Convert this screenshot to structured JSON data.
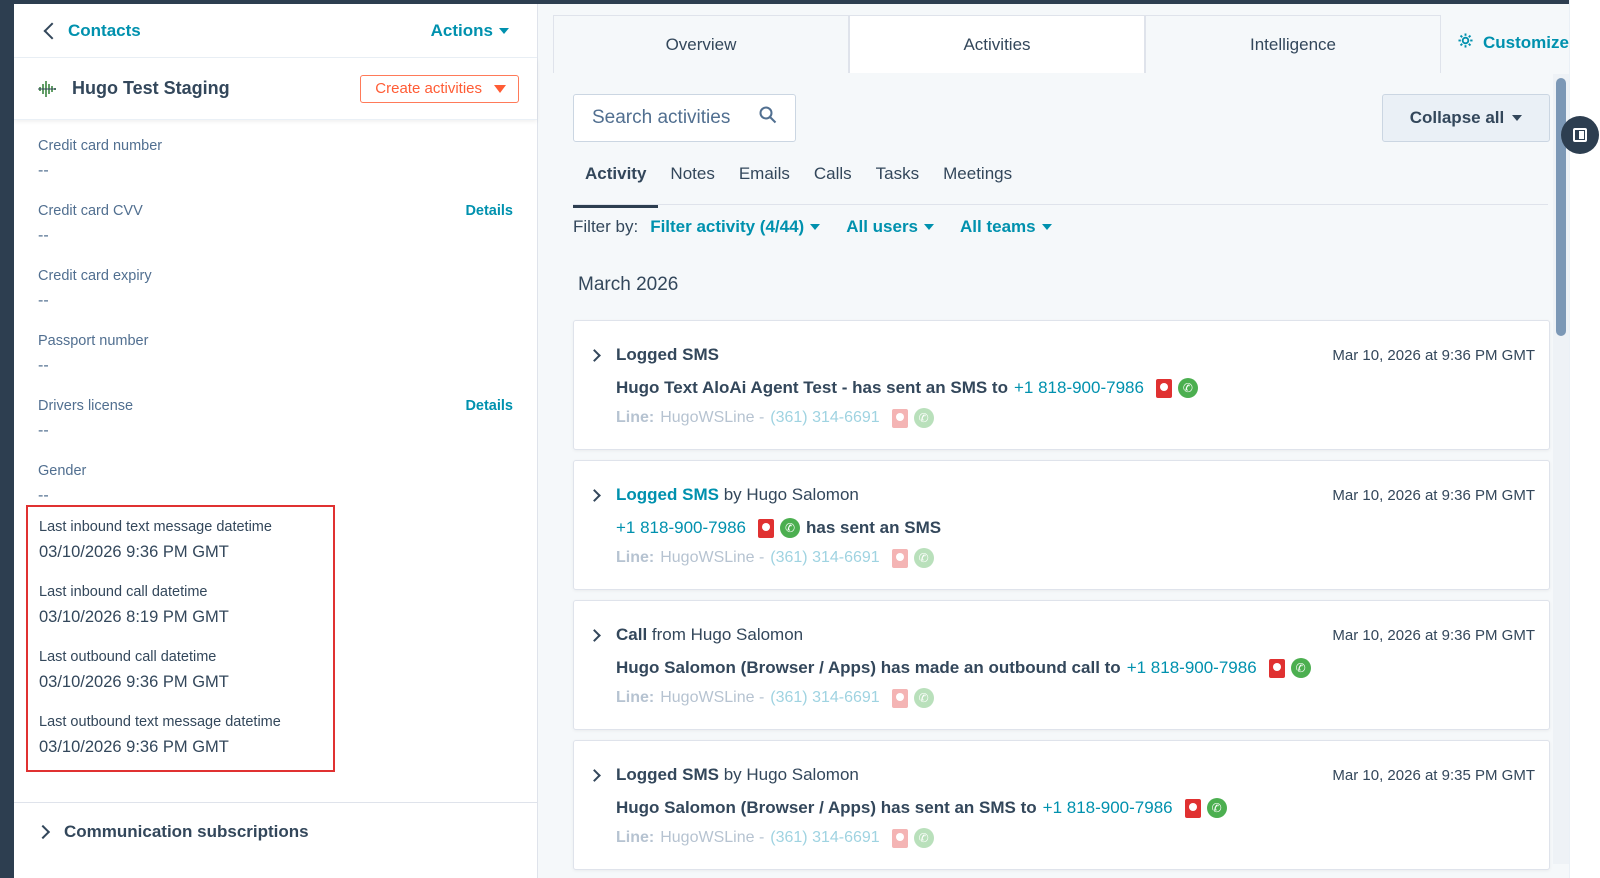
{
  "left": {
    "back_label": "Contacts",
    "actions_label": "Actions",
    "record_name": "Hugo Test Staging",
    "create_label": "Create activities",
    "props": [
      {
        "label": "Credit card number",
        "value": "--",
        "details": ""
      },
      {
        "label": "Credit card CVV",
        "value": "--",
        "details": "Details"
      },
      {
        "label": "Credit card expiry",
        "value": "--",
        "details": ""
      },
      {
        "label": "Passport number",
        "value": "--",
        "details": ""
      },
      {
        "label": "Drivers license",
        "value": "--",
        "details": "Details"
      },
      {
        "label": "Gender",
        "value": "--",
        "details": ""
      }
    ],
    "highlighted": [
      {
        "label": "Last inbound text message datetime",
        "value": "03/10/2026 9:36 PM GMT"
      },
      {
        "label": "Last inbound call datetime",
        "value": "03/10/2026 8:19 PM GMT"
      },
      {
        "label": "Last outbound call datetime",
        "value": "03/10/2026 9:36 PM GMT"
      },
      {
        "label": "Last outbound text message datetime",
        "value": "03/10/2026 9:36 PM GMT"
      }
    ],
    "comm_label": "Communication subscriptions"
  },
  "tabs": [
    "Overview",
    "Activities",
    "Intelligence"
  ],
  "customize_label": "Customize",
  "search": {
    "placeholder": "Search activities"
  },
  "collapse_label": "Collapse all",
  "subtabs": [
    "Activity",
    "Notes",
    "Emails",
    "Calls",
    "Tasks",
    "Meetings"
  ],
  "filter": {
    "label": "Filter by:",
    "activity": "Filter activity (4/44)",
    "users": "All users",
    "teams": "All teams"
  },
  "month": "March 2026",
  "cards": [
    {
      "type": "Logged SMS",
      "by": "",
      "author": "",
      "time": "Mar 10, 2026 at 9:36 PM GMT",
      "body_pre": "Hugo Text AloAi Agent Test - has sent an SMS to",
      "body_link": "+1 818-900-7986",
      "body_post": "",
      "line_label": "Line:",
      "line_name": "HugoWSLine -",
      "line_num": "(361) 314-6691"
    },
    {
      "type": "Logged SMS",
      "by": "by",
      "author": "Hugo Salomon",
      "time": "Mar 10, 2026 at 9:36 PM GMT",
      "body_pre": "",
      "body_link": "+1 818-900-7986",
      "body_post": "has sent an SMS",
      "line_label": "Line:",
      "line_name": "HugoWSLine -",
      "line_num": "(361) 314-6691"
    },
    {
      "type": "Call",
      "by": "from",
      "author": "Hugo Salomon",
      "time": "Mar 10, 2026 at 9:36 PM GMT",
      "body_pre": "Hugo Salomon (Browser / Apps) has made an outbound call to",
      "body_link": "+1 818-900-7986",
      "body_post": "",
      "line_label": "Line:",
      "line_name": "HugoWSLine -",
      "line_num": "(361) 314-6691"
    },
    {
      "type": "Logged SMS",
      "by": "by",
      "author": "Hugo Salomon",
      "time": "Mar 10, 2026 at 9:35 PM GMT",
      "body_pre": "Hugo Salomon (Browser / Apps) has sent an SMS to",
      "body_link": "+1 818-900-7986",
      "body_post": "",
      "line_label": "Line:",
      "line_name": "HugoWSLine -",
      "line_num": "(361) 314-6691"
    }
  ]
}
